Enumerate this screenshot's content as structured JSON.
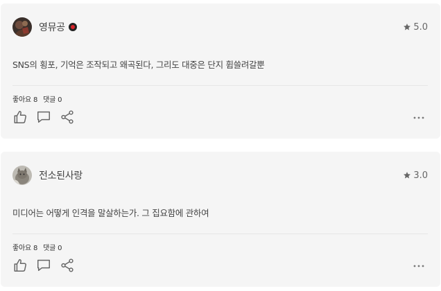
{
  "reviews": [
    {
      "author": "영뮤공",
      "avatar_icon": "avatar-dark-painting-icon",
      "has_badge": true,
      "badge_color": "#d8232a",
      "rating": "5.0",
      "text": "SNS의 횡포, 기억은 조작되고 왜곡된다, 그리도 대중은 단지 휩쓸려갈뿐",
      "likes_label": "좋아요",
      "likes_count": "8",
      "comments_label": "댓글",
      "comments_count": "0"
    },
    {
      "author": "전소된사랑",
      "avatar_icon": "avatar-cat-photo-icon",
      "has_badge": false,
      "rating": "3.0",
      "text": "미디어는 어떻게 인격을 말살하는가. 그 집요함에 관하여",
      "likes_label": "좋아요",
      "likes_count": "8",
      "comments_label": "댓글",
      "comments_count": "0"
    }
  ],
  "icons": {
    "star": "star-icon",
    "like": "thumbs-up-icon",
    "comment": "comment-icon",
    "share": "share-icon",
    "more": "more-dots-icon"
  },
  "colors": {
    "card_background": "#f5f5f5",
    "icon_gray": "#666666",
    "star_gray": "#666666"
  }
}
